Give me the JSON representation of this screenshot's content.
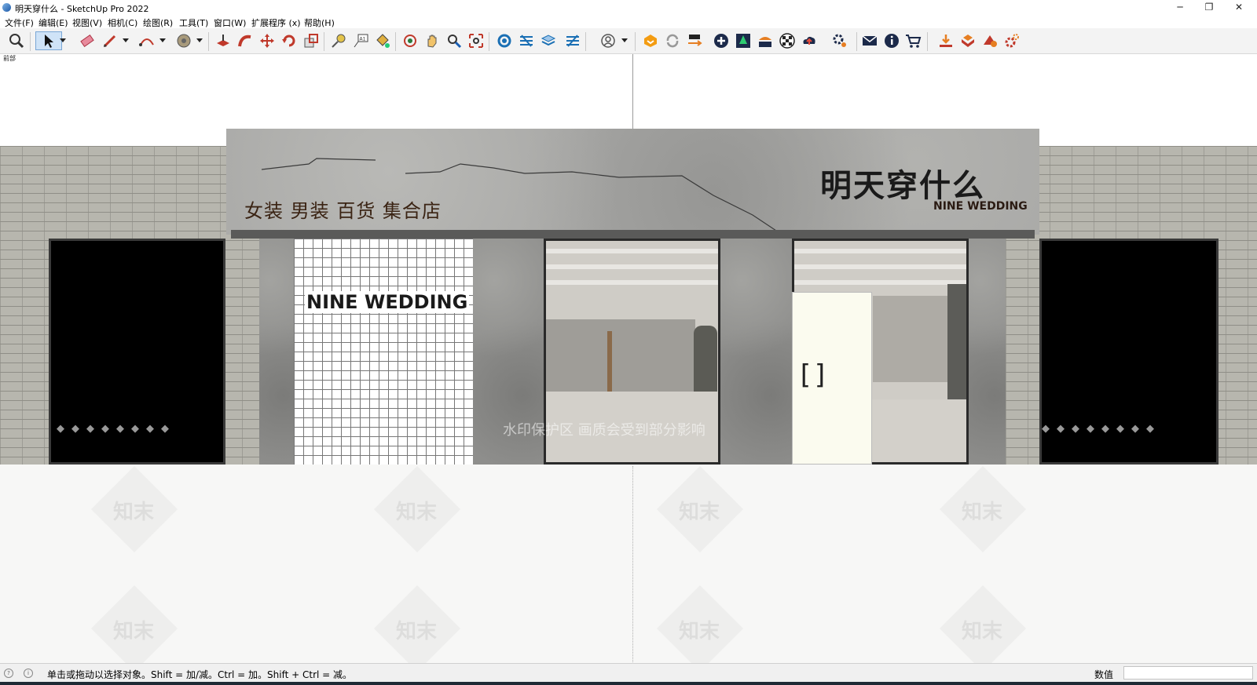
{
  "window": {
    "title": "明天穿什么 - SketchUp Pro 2022",
    "minimize": "─",
    "maximize": "❐",
    "close": "✕"
  },
  "menu": [
    {
      "label": "文件(F)"
    },
    {
      "label": "编辑(E)"
    },
    {
      "label": "视图(V)"
    },
    {
      "label": "相机(C)"
    },
    {
      "label": "绘图(R)"
    },
    {
      "label": "工具(T)"
    },
    {
      "label": "窗口(W)"
    },
    {
      "label": "扩展程序 (x)"
    },
    {
      "label": "帮助(H)"
    }
  ],
  "toolbar": {
    "icons": [
      "zoom-icon",
      "select-icon",
      "eraser-icon",
      "pencil-icon",
      "arc-icon",
      "paint-icon",
      "push-pull-icon",
      "follow-me-icon",
      "move-icon",
      "rotate-icon",
      "scale-icon",
      "tape-measure-icon",
      "text-icon",
      "paint-bucket-icon",
      "orbit-icon",
      "pan-icon",
      "zoom-window-icon",
      "zoom-extents-icon",
      "outliner-icon",
      "layers-icon",
      "styles-icon",
      "scenes-icon",
      "account-icon",
      "extension-warehouse-icon",
      "refresh-icon",
      "transfer-icon",
      "add-icon",
      "tree-icon",
      "shelf-icon",
      "checker-icon",
      "cloud-icon",
      "settings-icon",
      "mail-icon",
      "info-icon",
      "cart-icon",
      "import-icon",
      "export-icon",
      "render-icon",
      "gear-icon"
    ]
  },
  "viewport": {
    "scene_label": "前部",
    "sign_name_cn": "明天穿什么",
    "sign_name_en": "NINE WEDDING",
    "sign_categories": "女装  男装  百货  集合店",
    "tile_text": "NINE WEDDING",
    "door_handle": "[]",
    "watermark_line": "水印保护区  画质会受到部分影响",
    "watermark_brand": "知末",
    "dots": "◆◆◆◆◆◆◆◆"
  },
  "statusbar": {
    "hint": "单击或拖动以选择对象。Shift = 加/减。Ctrl = 加。Shift + Ctrl = 减。",
    "value_label": "数值",
    "value": ""
  },
  "colors": {
    "toolbar_bg": "#f3f3f3",
    "selected_tool": "#cfe3f7",
    "fascia_gray": "#a7a7a5",
    "sign_text": "#1a1a1a",
    "category_text": "#3b2414"
  }
}
